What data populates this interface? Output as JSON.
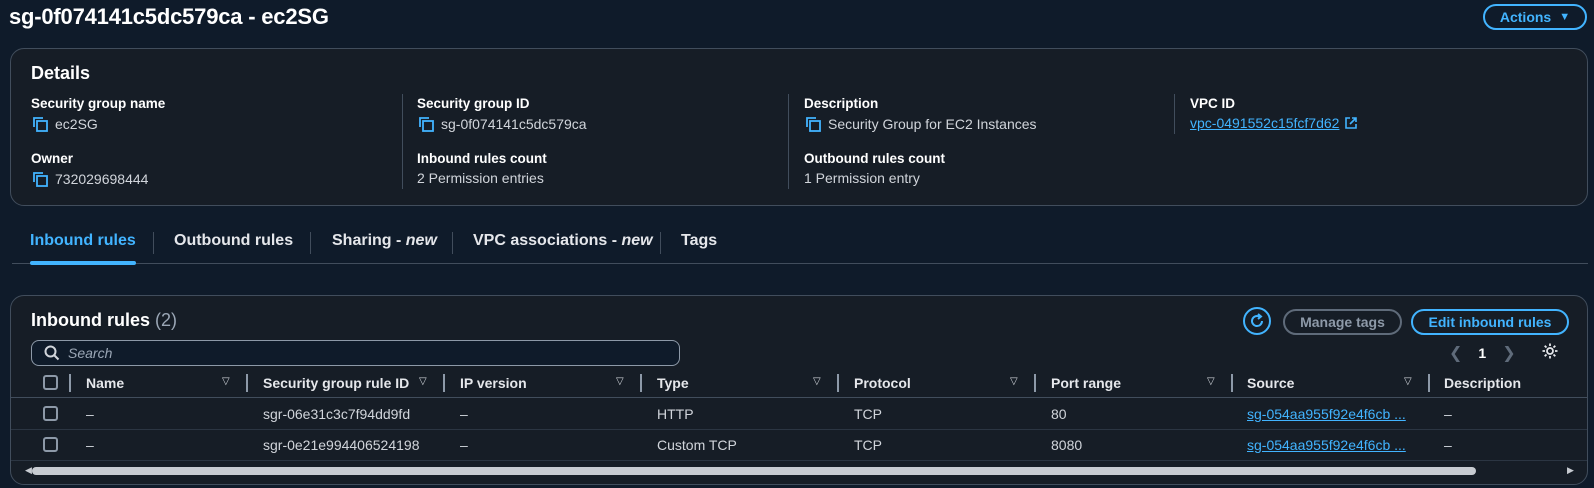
{
  "header": {
    "title": "sg-0f074141c5dc579ca - ec2SG",
    "actions_label": "Actions"
  },
  "details": {
    "title": "Details",
    "security_group_name": {
      "label": "Security group name",
      "value": "ec2SG"
    },
    "security_group_id": {
      "label": "Security group ID",
      "value": "sg-0f074141c5dc579ca"
    },
    "description": {
      "label": "Description",
      "value": "Security Group for EC2 Instances"
    },
    "vpc_id": {
      "label": "VPC ID",
      "value": "vpc-0491552c15fcf7d62"
    },
    "owner": {
      "label": "Owner",
      "value": "732029698444"
    },
    "inbound_rules_count": {
      "label": "Inbound rules count",
      "value": "2 Permission entries"
    },
    "outbound_rules_count": {
      "label": "Outbound rules count",
      "value": "1 Permission entry"
    }
  },
  "tabs": [
    {
      "label": "Inbound rules",
      "suffix": "",
      "active": true
    },
    {
      "label": "Outbound rules",
      "suffix": "",
      "active": false
    },
    {
      "label": "Sharing - ",
      "suffix": "new",
      "active": false
    },
    {
      "label": "VPC associations - ",
      "suffix": "new",
      "active": false
    },
    {
      "label": "Tags",
      "suffix": "",
      "active": false
    }
  ],
  "inbound": {
    "title": "Inbound rules",
    "count": "(2)",
    "manage_tags_label": "Manage tags",
    "edit_label": "Edit inbound rules",
    "search_placeholder": "Search",
    "page": "1",
    "columns": [
      "Name",
      "Security group rule ID",
      "IP version",
      "Type",
      "Protocol",
      "Port range",
      "Source",
      "Description"
    ],
    "rows": [
      {
        "name": "–",
        "rule_id": "sgr-06e31c3c7f94dd9fd",
        "ip_version": "–",
        "type": "HTTP",
        "protocol": "TCP",
        "port_range": "80",
        "source": "sg-054aa955f92e4f6cb ...",
        "description": "–"
      },
      {
        "name": "–",
        "rule_id": "sgr-0e21e994406524198",
        "ip_version": "–",
        "type": "Custom TCP",
        "protocol": "TCP",
        "port_range": "8080",
        "source": "sg-054aa955f92e4f6cb ...",
        "description": "–"
      }
    ]
  },
  "colors": {
    "background": "#0f1b2a",
    "panel": "#161d26",
    "accent": "#42b4ff",
    "border": "#414d5c"
  },
  "icons": {
    "copy": "copy-icon",
    "external": "external-link-icon",
    "refresh": "refresh-icon",
    "search": "search-icon",
    "settings": "gear-icon"
  }
}
